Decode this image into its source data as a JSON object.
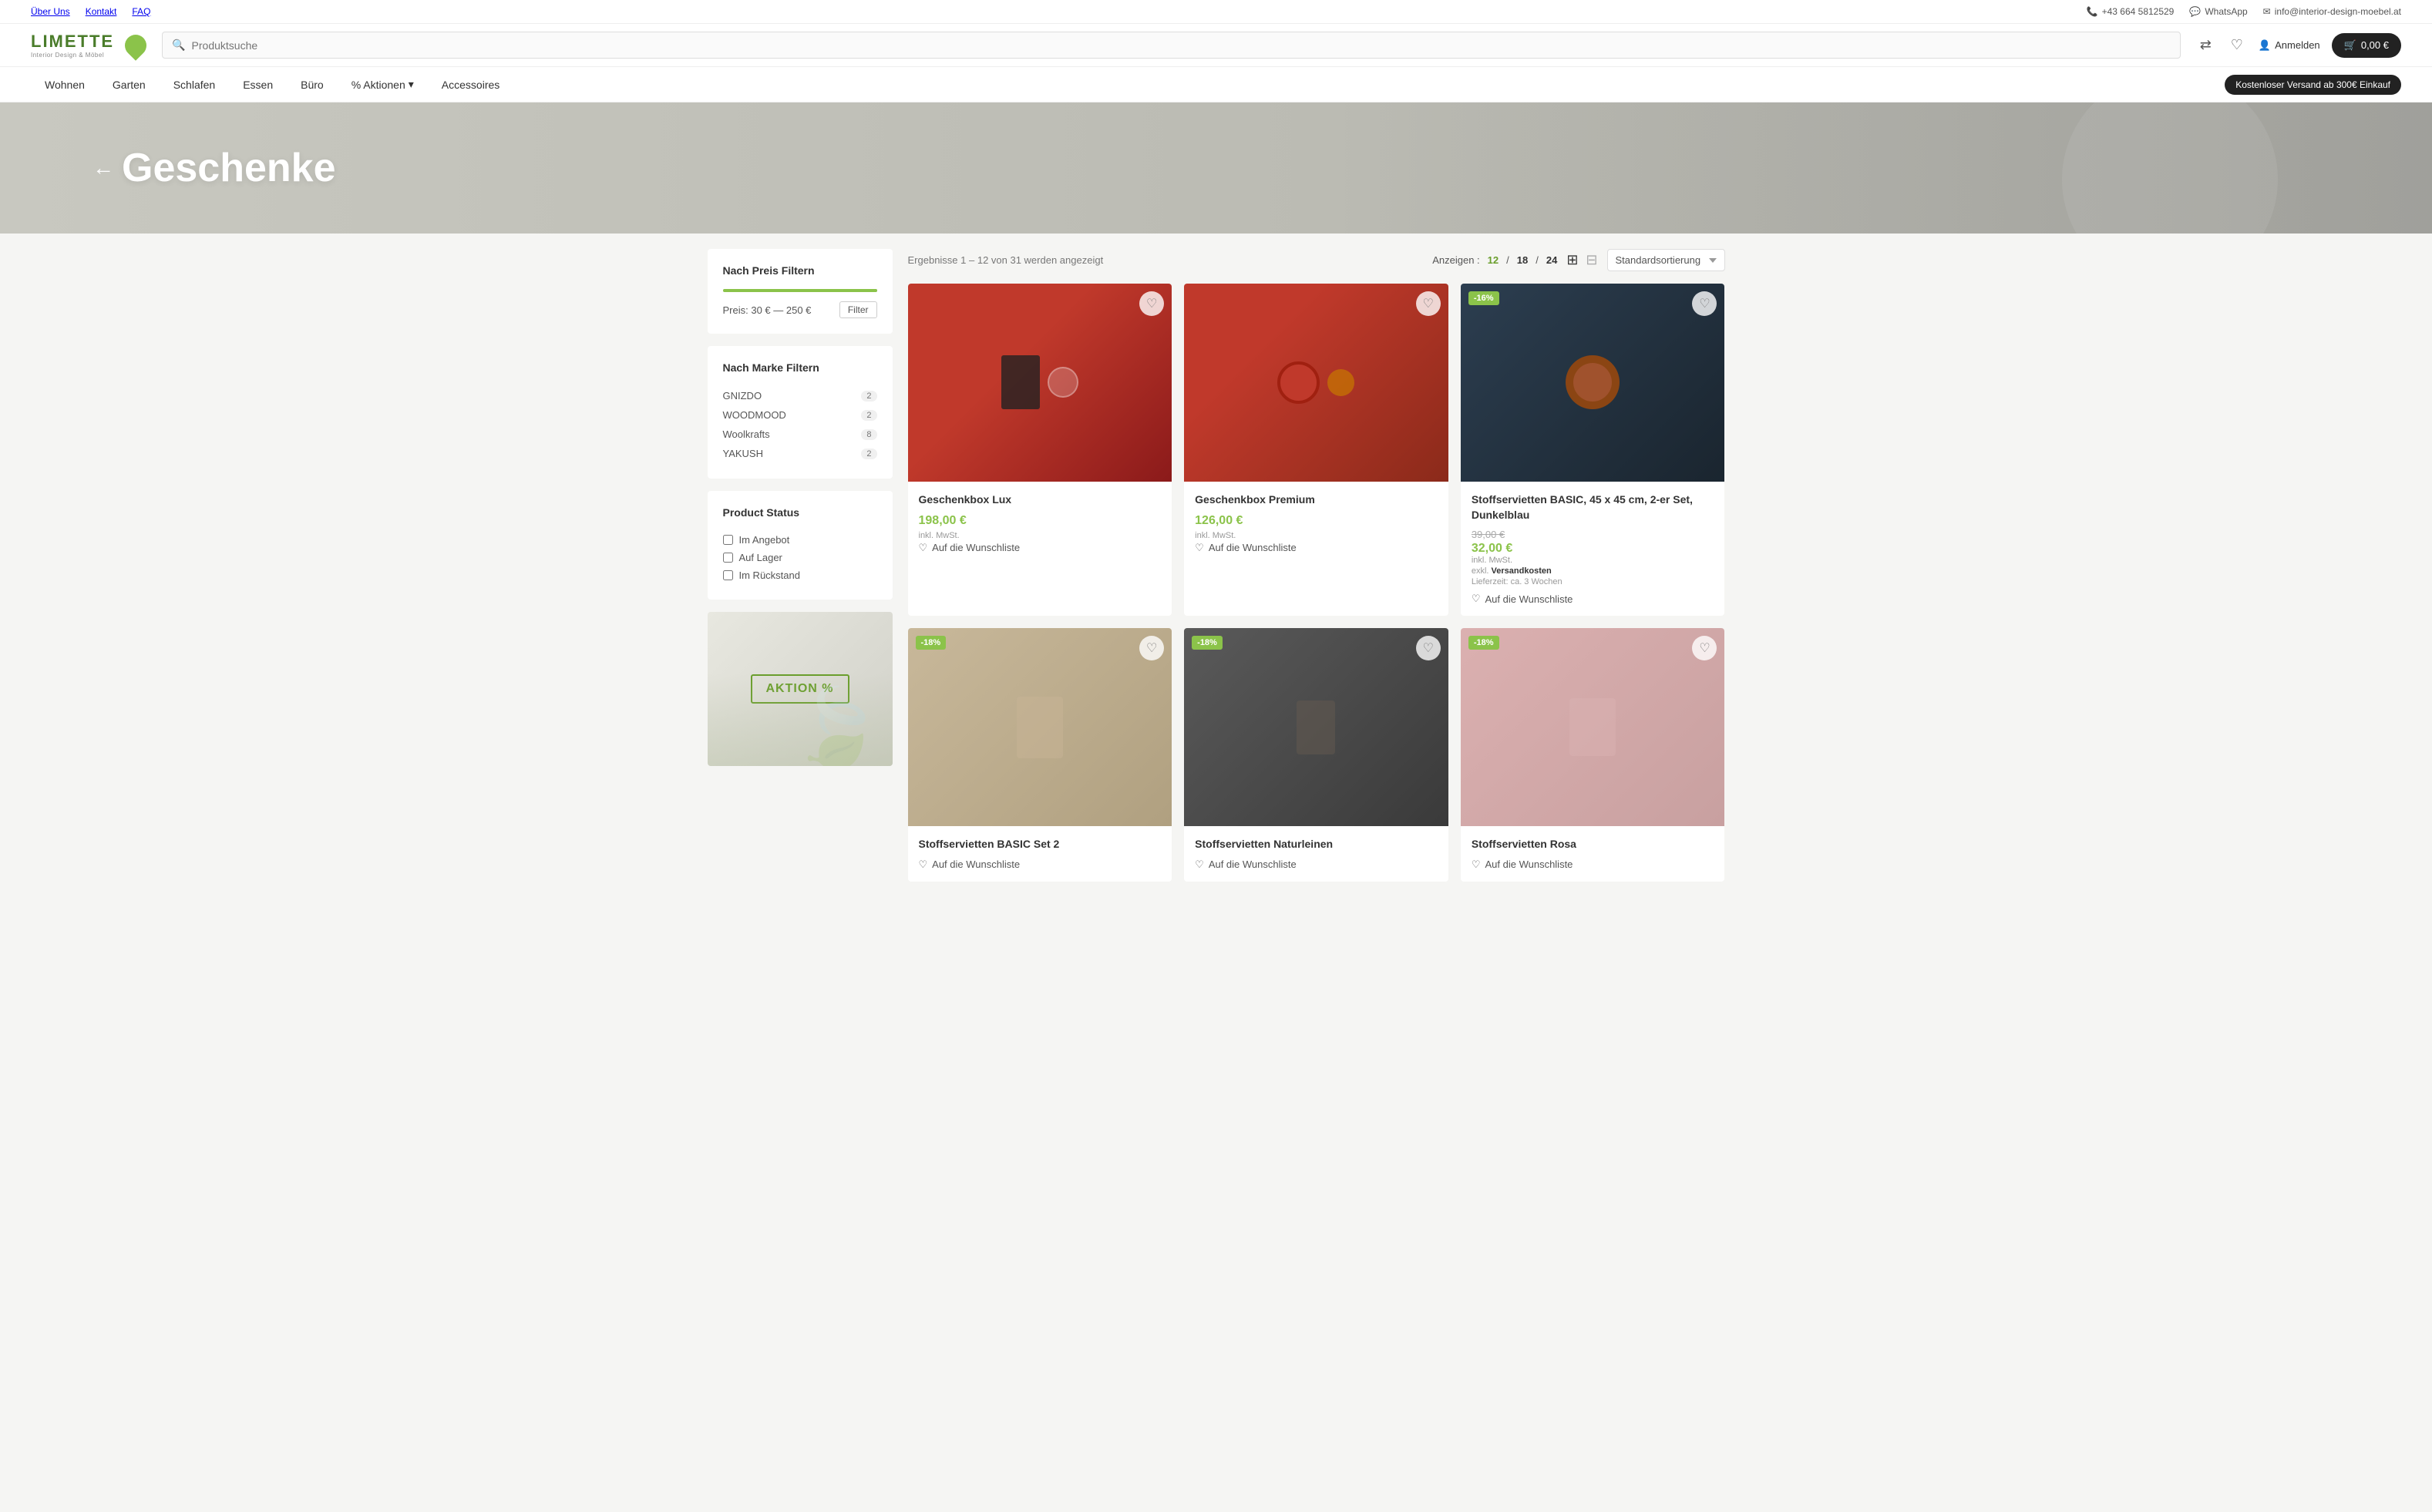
{
  "topbar": {
    "left": [
      "Über Uns",
      "Kontakt",
      "FAQ"
    ],
    "phone": "+43 664 5812529",
    "whatsapp": "WhatsApp",
    "email": "info@interior-design-moebel.at"
  },
  "header": {
    "logo_text": "LIMETTE",
    "logo_sub": "Interior Design\n& Möbel",
    "search_placeholder": "Produktsuche",
    "login_label": "Anmelden",
    "cart_label": "0,00 €"
  },
  "nav": {
    "links": [
      "Wohnen",
      "Garten",
      "Schlafen",
      "Essen",
      "Büro",
      "% Aktionen",
      "Accessoires"
    ],
    "free_shipping": "Kostenloser Versand ab 300€ Einkauf"
  },
  "hero": {
    "back_arrow": "←",
    "title": "Geschenke"
  },
  "sidebar": {
    "price_filter_title": "Nach Preis Filtern",
    "price_range": "Preis: 30 € — 250 €",
    "filter_btn": "Filter",
    "brand_filter_title": "Nach Marke Filtern",
    "brands": [
      {
        "name": "GNIZDO",
        "count": "2"
      },
      {
        "name": "WOODMOOD",
        "count": "2"
      },
      {
        "name": "Woolkrafts",
        "count": "8"
      },
      {
        "name": "YAKUSH",
        "count": "2"
      }
    ],
    "status_title": "Product Status",
    "statuses": [
      "Im Angebot",
      "Auf Lager",
      "Im Rückstand"
    ],
    "aktion_btn": "AKTION %"
  },
  "products": {
    "results_text": "Ergebnisse 1 – 12 von 31 werden angezeigt",
    "display_label": "Anzeigen :",
    "display_options": [
      "12",
      "18",
      "24"
    ],
    "active_display": "12",
    "sort_label": "Standardsortierung",
    "items": [
      {
        "name": "Geschenkbox Lux",
        "price": "198,00 €",
        "price_type": "single",
        "tax": "inkl. MwSt.",
        "wishlist": "Auf die Wunschliste",
        "img_class": "img-red",
        "discount": null,
        "old_price": null,
        "new_price": null,
        "shipping": null,
        "delivery": null
      },
      {
        "name": "Geschenkbox Premium",
        "price": "126,00 €",
        "price_type": "single",
        "tax": "inkl. MwSt.",
        "wishlist": "Auf die Wunschliste",
        "img_class": "img-red",
        "discount": null,
        "old_price": null,
        "new_price": null,
        "shipping": null,
        "delivery": null
      },
      {
        "name": "Stoffservietten BASIC, 45 x 45 cm, 2-er Set, Dunkelblau",
        "price": null,
        "price_type": "sale",
        "old_price": "39,00 €",
        "new_price": "32,00 €",
        "tax": "inkl. MwSt.",
        "shipping_label": "exkl.",
        "shipping_link": "Versandkosten",
        "delivery": "Lieferzeit: ca. 3 Wochen",
        "wishlist": "Auf die Wunschliste",
        "img_class": "img-dark",
        "discount": "-16%"
      },
      {
        "name": "Stoffservietten BASIC Set 2",
        "price": null,
        "price_type": "promo",
        "old_price": null,
        "new_price": null,
        "tax": null,
        "wishlist": "Auf die Wunschliste",
        "img_class": "img-beige",
        "discount": "-18%"
      },
      {
        "name": "Stoffservietten Naturleinen",
        "price": null,
        "price_type": "promo",
        "old_price": null,
        "new_price": null,
        "tax": null,
        "wishlist": "Auf die Wunschliste",
        "img_class": "img-dark2",
        "discount": "-18%"
      },
      {
        "name": "Stoffservietten Rosa",
        "price": null,
        "price_type": "promo",
        "old_price": null,
        "new_price": null,
        "tax": null,
        "wishlist": "Auf die Wunschliste",
        "img_class": "img-pink",
        "discount": "-18%"
      }
    ]
  },
  "icons": {
    "phone": "📞",
    "whatsapp": "💬",
    "email": "✉",
    "search": "🔍",
    "shuffle": "⇄",
    "heart": "♡",
    "heart_filled": "♡",
    "user": "👤",
    "cart": "🛒",
    "chevron": "▾",
    "grid3": "⊞",
    "grid4": "⊟"
  },
  "colors": {
    "accent": "#8bc34a",
    "dark": "#222222",
    "price_green": "#8bc34a"
  }
}
